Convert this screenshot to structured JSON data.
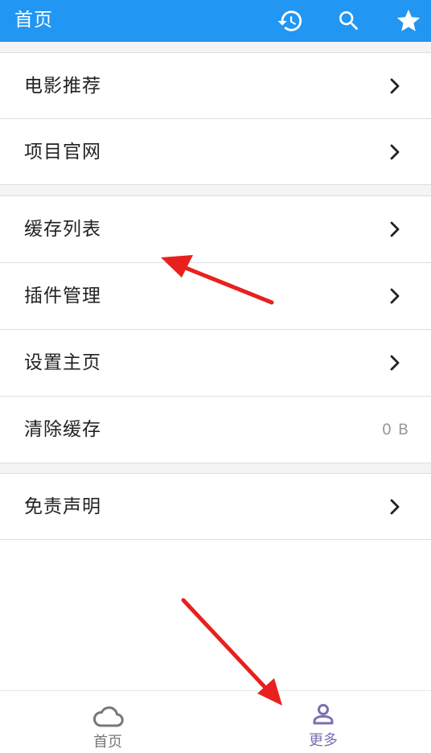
{
  "appbar": {
    "title": "首页",
    "background": "#2196F3",
    "icons": [
      "history-icon",
      "search-icon",
      "star-icon"
    ]
  },
  "menu": {
    "groups": [
      [
        {
          "label": "电影推荐",
          "trailing": "chevron-right-icon"
        },
        {
          "label": "项目官网",
          "trailing": "chevron-right-icon"
        }
      ],
      [
        {
          "label": "缓存列表",
          "trailing": "chevron-right-icon"
        },
        {
          "label": "插件管理",
          "trailing": "chevron-right-icon"
        },
        {
          "label": "设置主页",
          "trailing": "chevron-right-icon"
        },
        {
          "label": "清除缓存",
          "value": "0 B"
        }
      ],
      [
        {
          "label": "免责声明",
          "trailing": "chevron-right-icon"
        }
      ]
    ]
  },
  "bottom_nav": {
    "tabs": [
      {
        "label": "首页",
        "icon": "cloud-icon",
        "color": "#777777",
        "active": false
      },
      {
        "label": "更多",
        "icon": "person-icon",
        "color": "#7B6FB2",
        "active": true
      }
    ]
  },
  "annotations": {
    "arrow_color": "#E8211E"
  }
}
